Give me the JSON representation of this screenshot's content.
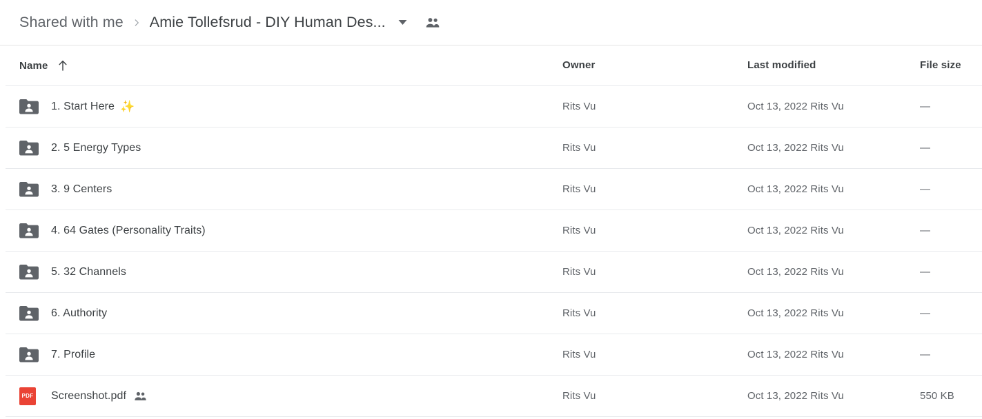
{
  "breadcrumb": {
    "root_label": "Shared with me",
    "separator_icon": "chevron-right-icon",
    "current_label": "Amie Tollefsrud - DIY Human Des...",
    "caret_icon": "chevron-down-icon",
    "people_icon": "shared-people-icon"
  },
  "table": {
    "columns": {
      "name": "Name",
      "owner": "Owner",
      "last_modified": "Last modified",
      "file_size": "File size"
    },
    "sort": {
      "column": "Name",
      "direction_icon": "arrow-up-icon"
    },
    "rows": [
      {
        "icon": "shared-folder-icon",
        "name": "1. Start Here",
        "emoji": "✨",
        "shared_badge": false,
        "owner": "Rits Vu",
        "last_modified": "Oct 13, 2022 Rits Vu",
        "file_size": "—"
      },
      {
        "icon": "shared-folder-icon",
        "name": "2. 5 Energy Types",
        "emoji": "",
        "shared_badge": false,
        "owner": "Rits Vu",
        "last_modified": "Oct 13, 2022 Rits Vu",
        "file_size": "—"
      },
      {
        "icon": "shared-folder-icon",
        "name": "3. 9 Centers",
        "emoji": "",
        "shared_badge": false,
        "owner": "Rits Vu",
        "last_modified": "Oct 13, 2022 Rits Vu",
        "file_size": "—"
      },
      {
        "icon": "shared-folder-icon",
        "name": "4. 64 Gates (Personality Traits)",
        "emoji": "",
        "shared_badge": false,
        "owner": "Rits Vu",
        "last_modified": "Oct 13, 2022 Rits Vu",
        "file_size": "—"
      },
      {
        "icon": "shared-folder-icon",
        "name": "5. 32 Channels",
        "emoji": "",
        "shared_badge": false,
        "owner": "Rits Vu",
        "last_modified": "Oct 13, 2022 Rits Vu",
        "file_size": "—"
      },
      {
        "icon": "shared-folder-icon",
        "name": "6. Authority",
        "emoji": "",
        "shared_badge": false,
        "owner": "Rits Vu",
        "last_modified": "Oct 13, 2022 Rits Vu",
        "file_size": "—"
      },
      {
        "icon": "shared-folder-icon",
        "name": "7. Profile",
        "emoji": "",
        "shared_badge": false,
        "owner": "Rits Vu",
        "last_modified": "Oct 13, 2022 Rits Vu",
        "file_size": "—"
      },
      {
        "icon": "pdf-file-icon",
        "icon_label": "PDF",
        "name": "Screenshot.pdf",
        "emoji": "",
        "shared_badge": true,
        "owner": "Rits Vu",
        "last_modified": "Oct 13, 2022 Rits Vu",
        "file_size": "550 KB"
      }
    ]
  },
  "colors": {
    "text_primary": "#3c4043",
    "text_secondary": "#5f6368",
    "folder_icon": "#5f6368",
    "pdf_red": "#ea4335",
    "divider": "#e8eaed",
    "background": "#ffffff"
  }
}
